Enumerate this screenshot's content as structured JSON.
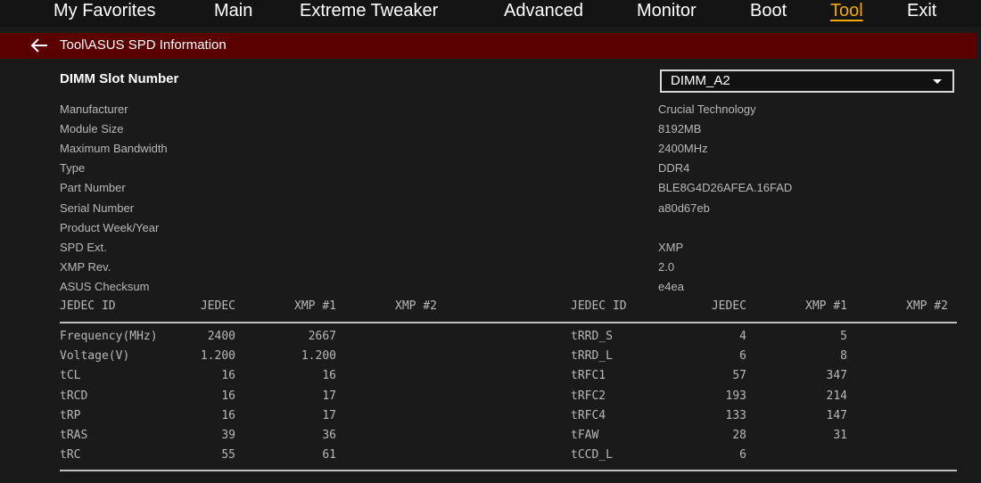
{
  "nav": [
    {
      "label": "My Favorites",
      "active": false
    },
    {
      "label": "Main",
      "active": false
    },
    {
      "label": "Extreme Tweaker",
      "active": false
    },
    {
      "label": "Advanced",
      "active": false
    },
    {
      "label": "Monitor",
      "active": false
    },
    {
      "label": "Boot",
      "active": false
    },
    {
      "label": "Tool",
      "active": true
    },
    {
      "label": "Exit",
      "active": false
    }
  ],
  "breadcrumb": "Tool\\ASUS SPD Information",
  "dimm": {
    "label": "DIMM Slot Number",
    "value": "DIMM_A2"
  },
  "info": [
    {
      "label": "Manufacturer",
      "value": "Crucial Technology"
    },
    {
      "label": "Module Size",
      "value": "8192MB"
    },
    {
      "label": "Maximum Bandwidth",
      "value": "2400MHz"
    },
    {
      "label": "Type",
      "value": "DDR4"
    },
    {
      "label": "Part Number",
      "value": "BLE8G4D26AFEA.16FAD"
    },
    {
      "label": "Serial Number",
      "value": "a80d67eb"
    },
    {
      "label": "Product Week/Year",
      "value": ""
    },
    {
      "label": "SPD Ext.",
      "value": "XMP"
    },
    {
      "label": "XMP Rev.",
      "value": "2.0"
    },
    {
      "label": "ASUS Checksum",
      "value": "e4ea"
    }
  ],
  "table_left": {
    "headers": [
      "JEDEC ID",
      "JEDEC",
      "XMP #1",
      "XMP #2"
    ],
    "rows": [
      [
        "Frequency(MHz)",
        "2400",
        "2667",
        ""
      ],
      [
        "Voltage(V)",
        "1.200",
        "1.200",
        ""
      ],
      [
        "tCL",
        "16",
        "16",
        ""
      ],
      [
        "tRCD",
        "16",
        "17",
        ""
      ],
      [
        "tRP",
        "16",
        "17",
        ""
      ],
      [
        "tRAS",
        "39",
        "36",
        ""
      ],
      [
        "tRC",
        "55",
        "61",
        ""
      ]
    ]
  },
  "table_right": {
    "headers": [
      "JEDEC ID",
      "JEDEC",
      "XMP #1",
      "XMP #2"
    ],
    "rows": [
      [
        "tRRD_S",
        "4",
        "5",
        ""
      ],
      [
        "tRRD_L",
        "6",
        "8",
        ""
      ],
      [
        "tRFC1",
        "57",
        "347",
        ""
      ],
      [
        "tRFC2",
        "193",
        "214",
        ""
      ],
      [
        "tRFC4",
        "133",
        "147",
        ""
      ],
      [
        "tFAW",
        "28",
        "31",
        ""
      ],
      [
        "tCCD_L",
        "6",
        "",
        ""
      ]
    ]
  },
  "colors": {
    "accent": "#f2a900",
    "header_bar": "#5a0000",
    "background": "#1a1a1a"
  }
}
